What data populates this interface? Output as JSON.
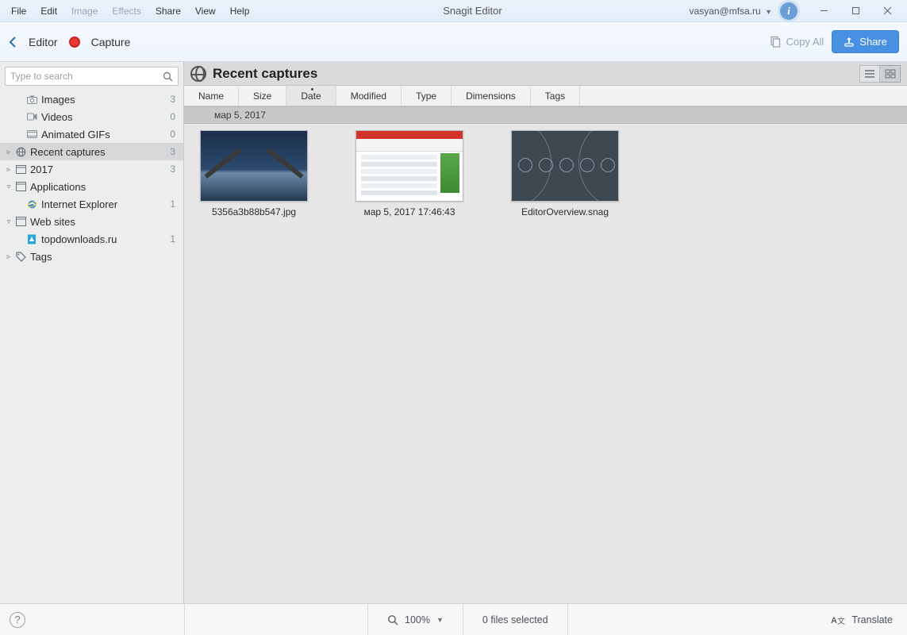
{
  "window": {
    "title": "Snagit Editor"
  },
  "menu": [
    "File",
    "Edit",
    "Image",
    "Effects",
    "Share",
    "View",
    "Help"
  ],
  "menu_disabled": [
    2,
    3
  ],
  "user": {
    "email": "vasyan@mfsa.ru"
  },
  "toolbar": {
    "back_label": "Editor",
    "capture_label": "Capture",
    "copy_all": "Copy All",
    "share": "Share"
  },
  "search": {
    "placeholder": "Type to search"
  },
  "tree": [
    {
      "level": 1,
      "icon": "camera",
      "label": "Images",
      "count": "3"
    },
    {
      "level": 1,
      "icon": "video",
      "label": "Videos",
      "count": "0"
    },
    {
      "level": 1,
      "icon": "gif",
      "label": "Animated GIFs",
      "count": "0"
    },
    {
      "level": 0,
      "expander": "▹",
      "icon": "globe",
      "label": "Recent captures",
      "count": "3",
      "selected": true
    },
    {
      "level": 0,
      "expander": "▹",
      "icon": "calendar",
      "label": "2017",
      "count": "3"
    },
    {
      "level": 0,
      "expander": "▿",
      "icon": "window",
      "label": "Applications",
      "count": ""
    },
    {
      "level": 1,
      "icon": "ie",
      "label": "Internet Explorer",
      "count": "1"
    },
    {
      "level": 0,
      "expander": "▿",
      "icon": "window",
      "label": "Web sites",
      "count": ""
    },
    {
      "level": 1,
      "icon": "site",
      "label": "topdownloads.ru",
      "count": "1"
    },
    {
      "level": 0,
      "expander": "▹",
      "icon": "tag",
      "label": "Tags",
      "count": ""
    }
  ],
  "content": {
    "heading": "Recent captures",
    "columns": [
      "Name",
      "Size",
      "Date",
      "Modified",
      "Type",
      "Dimensions",
      "Tags"
    ],
    "sorted_column": 2,
    "date_group": "мар 5, 2017",
    "items": [
      {
        "caption": "5356a3b88b547.jpg",
        "kind": "bridge"
      },
      {
        "caption": "мар 5, 2017 17:46:43",
        "kind": "webpage"
      },
      {
        "caption": "EditorOverview.snag",
        "kind": "dark"
      }
    ]
  },
  "status": {
    "zoom": "100%",
    "selection": "0 files selected",
    "translate": "Translate"
  }
}
